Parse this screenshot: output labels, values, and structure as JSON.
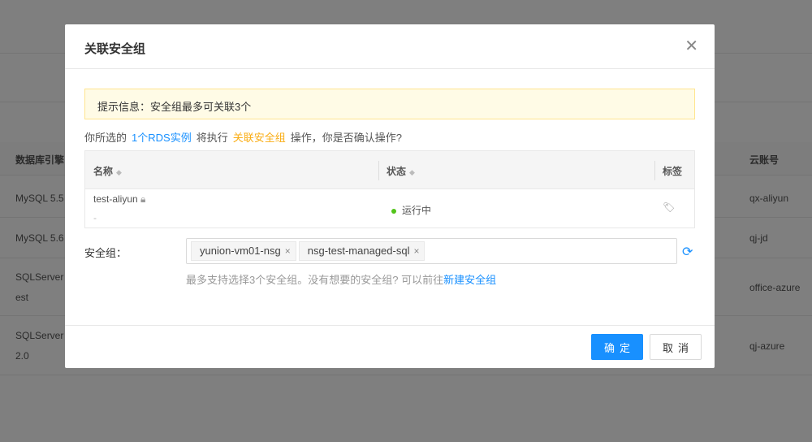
{
  "background": {
    "headers": {
      "engine": "数据库引擎",
      "account": "云账号"
    },
    "rows": [
      {
        "engine": "MySQL 5.5",
        "account": "qx-aliyun"
      },
      {
        "engine": "MySQL 5.6",
        "account": "qj-jd"
      },
      {
        "engine": "SQLServer",
        "engine2": "est",
        "account": "office-azure"
      },
      {
        "engine": "SQLServer",
        "engine2": "2.0",
        "account": "qj-azure"
      }
    ]
  },
  "modal": {
    "title": "关联安全组",
    "close_icon": "close-icon",
    "alert": "提示信息：安全组最多可关联3个",
    "confirm": {
      "prefix": "你所选的",
      "count": "1个RDS实例",
      "middle": "将执行",
      "action": "关联安全组",
      "suffix": "操作，你是否确认操作?"
    },
    "table": {
      "headers": {
        "name": "名称",
        "status": "状态",
        "tags": "标签"
      },
      "rows": [
        {
          "name": "test-aliyun",
          "sub": "-",
          "status": "运行中",
          "status_color": "#52c41a"
        }
      ]
    },
    "secgroup_label": "安全组：",
    "selected": [
      "yunion-vm01-nsg",
      "nsg-test-managed-sql"
    ],
    "hint": "最多支持选择3个安全组。没有想要的安全组? 可以前往",
    "hint_link": "新建安全组",
    "ok": "确定",
    "cancel": "取消"
  },
  "colors": {
    "primary": "#1890ff",
    "warning": "#faad14",
    "success": "#52c41a"
  }
}
